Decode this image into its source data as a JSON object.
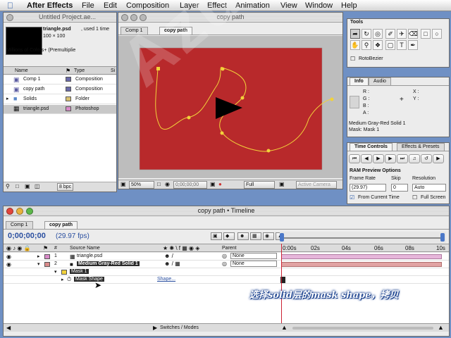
{
  "menubar": {
    "app_name": "After Effects",
    "menus": [
      "File",
      "Edit",
      "Composition",
      "Layer",
      "Effect",
      "Animation",
      "View",
      "Window",
      "Help"
    ]
  },
  "project": {
    "title": "Untitled Project.ae...",
    "selected_name": "triangle.psd",
    "used": ", used 1 time",
    "dimensions": "100 × 100",
    "colors": "Millions of Colors+ (Premultiplie",
    "col_name": "Name",
    "col_type": "Type",
    "col_size": "Si",
    "items": [
      {
        "name": "Comp 1",
        "type": "Composition",
        "color": "#6a6aa8"
      },
      {
        "name": "copy path",
        "type": "Composition",
        "color": "#6a6aa8"
      },
      {
        "name": "Solids",
        "type": "Folder",
        "color": "#d8c070"
      },
      {
        "name": "triangle.psd",
        "type": "Photoshop",
        "color": "#d88ac8"
      }
    ],
    "bpc": "8 bpc"
  },
  "comp": {
    "title": "copy path",
    "tabs": [
      "Comp 1",
      "copy path"
    ],
    "zoom": "50%",
    "timecode": "0;00;00;00",
    "resolution": "Full",
    "camera": "Active Camera",
    "bg_color": "#b8292b"
  },
  "tools": {
    "title": "Tools",
    "rotobezier": "RotoBezier"
  },
  "info": {
    "tabs": [
      "Info",
      "Audio"
    ],
    "r": "R :",
    "g": "G :",
    "b": "B :",
    "a": "A :",
    "x": "X :",
    "y": "Y :",
    "line1": "Medium Gray-Red Solid 1",
    "line2": "Mask: Mask 1"
  },
  "time_controls": {
    "tabs": [
      "Time Controls",
      "Effects & Presets"
    ],
    "ram_preview": "RAM Preview Options",
    "frame_rate_label": "Frame Rate",
    "skip_label": "Skip",
    "resolution_label": "Resolution",
    "frame_rate": "(29.97)",
    "skip": "0",
    "resolution": "Auto",
    "from_current": "From Current Time",
    "full_screen": "Full Screen"
  },
  "timeline": {
    "title": "copy path • Timeline",
    "tabs": [
      "Comp 1",
      "copy path"
    ],
    "timecode": "0;00;00;00",
    "fps": "(29.97 fps)",
    "col_source": "Source Name",
    "col_parent": "Parent",
    "ticks": [
      "0:00s",
      "02s",
      "04s",
      "06s",
      "08s",
      "10s"
    ],
    "layers": [
      {
        "num": "1",
        "name": "triangle.psd",
        "parent": "None",
        "color": "#d88ac8"
      },
      {
        "num": "2",
        "name": "Medium Gray-Red Solid 1",
        "parent": "None",
        "color": "#d98a8a"
      }
    ],
    "mask_name": "Mask 1",
    "mask_shape": "Mask Shape",
    "shape_link": "Shape...",
    "switches_modes": "Switches / Modes"
  },
  "annotation": "选择solid层的mask shape，拷贝",
  "watermark": "AzureZhi"
}
